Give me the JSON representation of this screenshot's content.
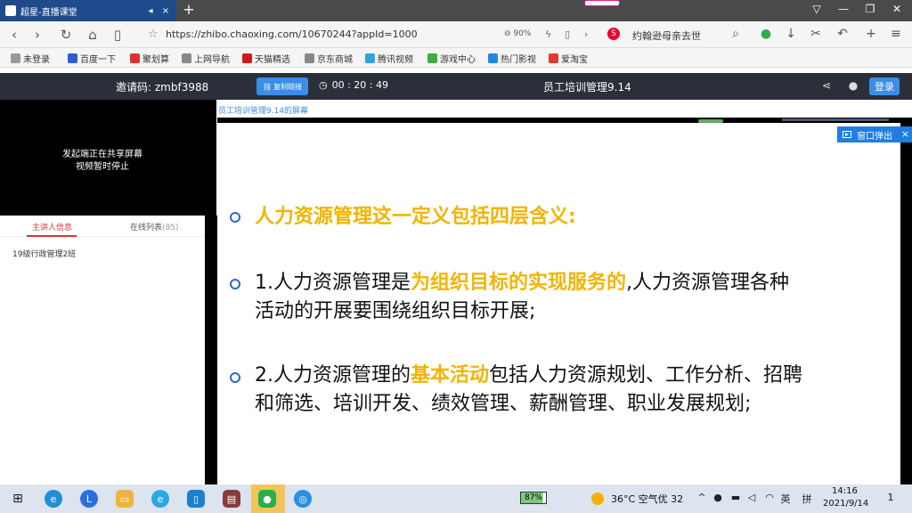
{
  "browser": {
    "tab_title": "超星-直播课堂",
    "tab_mute": "◂",
    "tab_close": "×",
    "new_tab": "+",
    "url": "https://zhibo.chaoxing.com/10670244?appId=1000",
    "zoom": "90%",
    "search_engine": "S",
    "search_text": "约翰逊母亲去世"
  },
  "bookmarks": [
    {
      "label": "未登录",
      "color": "#999999"
    },
    {
      "label": "百度一下",
      "color": "#2a5fd1"
    },
    {
      "label": "聚划算",
      "color": "#e0302c"
    },
    {
      "label": "上网导航",
      "color": "#888888"
    },
    {
      "label": "天猫精选",
      "color": "#d01919"
    },
    {
      "label": "京东商城",
      "color": "#888888"
    },
    {
      "label": "腾讯视频",
      "color": "#2aa5e0"
    },
    {
      "label": "游戏中心",
      "color": "#3fae3f"
    },
    {
      "label": "热门影视",
      "color": "#1e88e5"
    },
    {
      "label": "爱淘宝",
      "color": "#e03c2a"
    }
  ],
  "site": {
    "invite_label": "邀请码:  zmbf3988",
    "copy_link": "复制链接",
    "timer": "00 : 20 : 49",
    "room_title": "员工培训管理9.14",
    "login": "登录"
  },
  "left_panel": {
    "video_line1": "发起端正在共享屏幕",
    "video_line2": "视频暂时停止",
    "tab_host": "主讲人信息",
    "tab_online": "在线列表",
    "online_count": "(85)",
    "class_name": "19级行政管理2班"
  },
  "screen": {
    "label": "员工培训管理9.14的屏幕",
    "popout": "窗口弹出",
    "popout_close": "×"
  },
  "slide": {
    "b1_hl": "人力资源管理这一定义包括四层含义:",
    "b2_pre": "1.人力资源管理是",
    "b2_hl": "为组织目标的实现服务的",
    "b2_post": ",人力资源管理各种",
    "b2_l2": "活动的开展要围绕组织目标开展;",
    "b3_pre": "2.人力资源管理的",
    "b3_hl": "基本活动",
    "b3_post": "包括人力资源规划、工作分析、招聘",
    "b3_l2": "和筛选、培训开发、绩效管理、薪酬管理、职业发展规划;"
  },
  "taskbar": {
    "battery": "87%",
    "weather": "36°C  空气优 32",
    "lang": "英",
    "ime": "拼",
    "time": "14:16",
    "date": "2021/9/14",
    "notif_count": "1"
  },
  "colors": {
    "highlight": "#f2b400",
    "accent_blue": "#3a8ee6",
    "header_bg": "#2b2f3a"
  }
}
